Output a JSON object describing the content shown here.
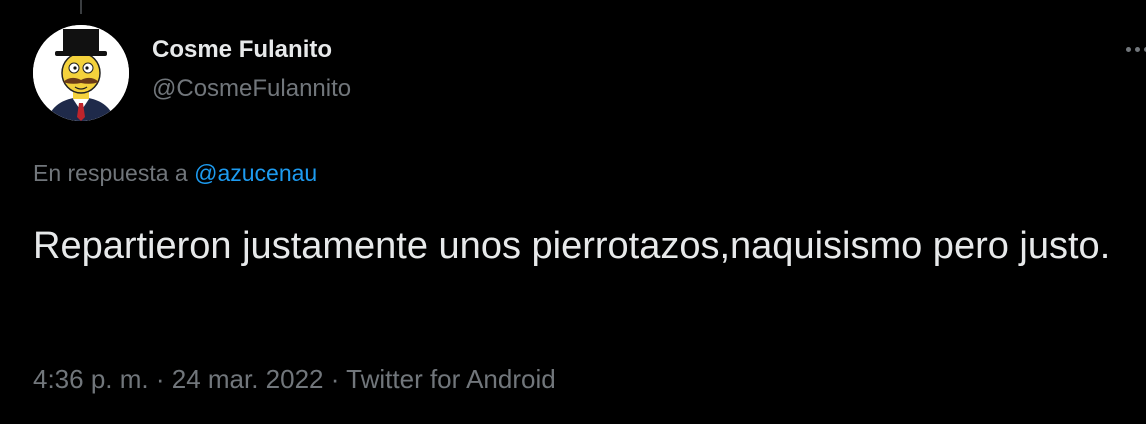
{
  "author": {
    "display_name": "Cosme Fulanito",
    "handle": "@CosmeFulannito",
    "avatar": "cartoon-man-top-hat-mustache"
  },
  "reply": {
    "prefix": "En respuesta a",
    "mention": "@azucenau"
  },
  "tweet": {
    "text": "Repartieron justamente unos pierrotazos,naquisismo pero justo."
  },
  "meta": {
    "time": "4:36 p. m.",
    "separator": " · ",
    "date": "24 mar. 2022",
    "source": "Twitter for Android"
  },
  "icons": {
    "more": "more-options-icon"
  },
  "colors": {
    "background": "#000000",
    "primary_text": "#e7e9ea",
    "secondary_text": "#71767b",
    "link": "#1d9bf0"
  }
}
